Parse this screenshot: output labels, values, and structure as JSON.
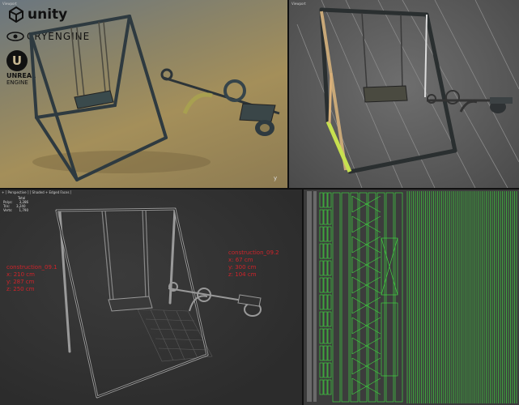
{
  "panels": {
    "top_left": {
      "tiny_label": "Viewport",
      "logos": {
        "unity": "unity",
        "cryengine": "CRYENGINE",
        "unreal_line1": "UNREAL",
        "unreal_line2": "ENGINE"
      },
      "corner_axis": "y"
    },
    "top_right": {
      "tiny_label": "Viewport"
    },
    "bottom_left": {
      "viewport_label": "+ [ Perspective ] [ Shaded + Edged Faces ]",
      "stats": {
        "header": "Total",
        "rows": [
          {
            "label": "Polys:",
            "value": "3,286"
          },
          {
            "label": "Tris:",
            "value": "3,240"
          },
          {
            "label": "Verts:",
            "value": "1,790"
          }
        ]
      },
      "annotations": [
        {
          "lines": [
            "construction_09.1",
            "x: 210 cm",
            "y: 287 cm",
            "z: 250 cm"
          ]
        },
        {
          "lines": [
            "construction_09.2",
            "x: 67 cm",
            "y: 300 cm",
            "z: 104 cm"
          ]
        }
      ]
    }
  },
  "colors": {
    "annotation_red": "#d0232a",
    "uv_green": "#3fd040",
    "wire": "#9a9a9a"
  }
}
